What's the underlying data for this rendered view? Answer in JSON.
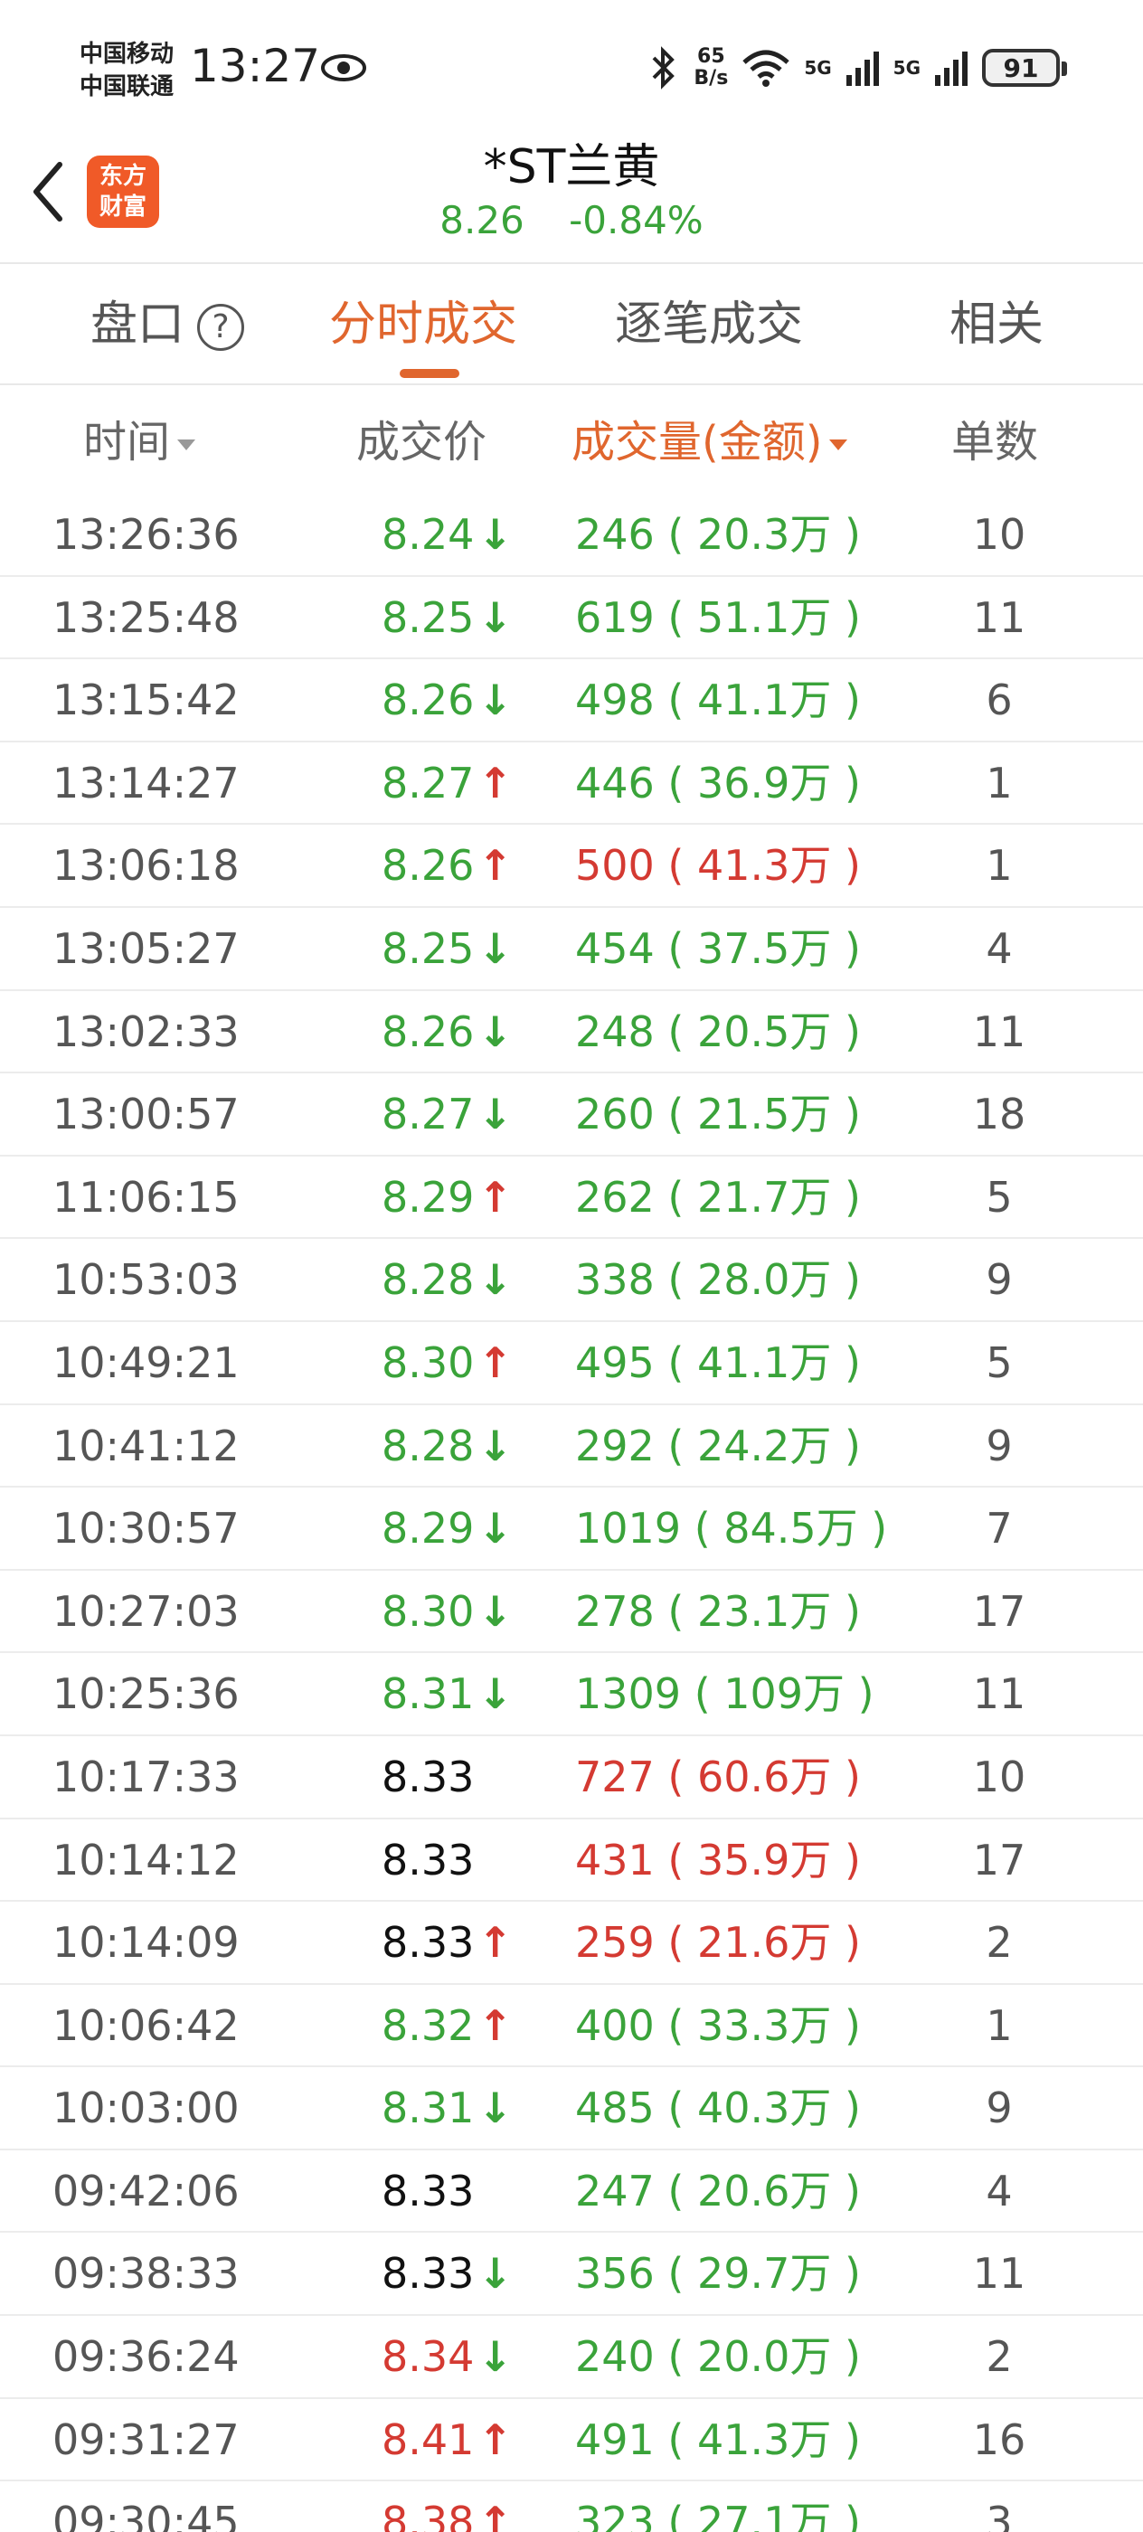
{
  "status_bar": {
    "carrier_1": "中国移动",
    "carrier_2": "中国联通",
    "time": "13:27",
    "net_speed_value": "65",
    "net_speed_unit": "B/s",
    "network_1": "5G",
    "network_2": "5G",
    "battery": "91"
  },
  "header": {
    "logo_line1": "东方",
    "logo_line2": "财富",
    "stock_name": "*ST兰黄",
    "price": "8.26",
    "change_pct": "-0.84%"
  },
  "tabs": [
    {
      "label": "盘口",
      "active": false
    },
    {
      "label": "分时成交",
      "active": true
    },
    {
      "label": "逐笔成交",
      "active": false
    },
    {
      "label": "相关",
      "active": false
    }
  ],
  "columns": {
    "time": "时间",
    "price": "成交价",
    "volume": "成交量(金额)",
    "count": "单数"
  },
  "trades": [
    {
      "time": "13:26:36",
      "price": "8.24",
      "price_color": "green",
      "dir": "down",
      "volume": "246 ( 20.3万 )",
      "vol_color": "green",
      "count": "10"
    },
    {
      "time": "13:25:48",
      "price": "8.25",
      "price_color": "green",
      "dir": "down",
      "volume": "619 ( 51.1万 )",
      "vol_color": "green",
      "count": "11"
    },
    {
      "time": "13:15:42",
      "price": "8.26",
      "price_color": "green",
      "dir": "down",
      "volume": "498 ( 41.1万 )",
      "vol_color": "green",
      "count": "6"
    },
    {
      "time": "13:14:27",
      "price": "8.27",
      "price_color": "green",
      "dir": "up",
      "volume": "446 ( 36.9万 )",
      "vol_color": "green",
      "count": "1"
    },
    {
      "time": "13:06:18",
      "price": "8.26",
      "price_color": "green",
      "dir": "up",
      "volume": "500 ( 41.3万 )",
      "vol_color": "red",
      "count": "1"
    },
    {
      "time": "13:05:27",
      "price": "8.25",
      "price_color": "green",
      "dir": "down",
      "volume": "454 ( 37.5万 )",
      "vol_color": "green",
      "count": "4"
    },
    {
      "time": "13:02:33",
      "price": "8.26",
      "price_color": "green",
      "dir": "down",
      "volume": "248 ( 20.5万 )",
      "vol_color": "green",
      "count": "11"
    },
    {
      "time": "13:00:57",
      "price": "8.27",
      "price_color": "green",
      "dir": "down",
      "volume": "260 ( 21.5万 )",
      "vol_color": "green",
      "count": "18"
    },
    {
      "time": "11:06:15",
      "price": "8.29",
      "price_color": "green",
      "dir": "up",
      "volume": "262 ( 21.7万 )",
      "vol_color": "green",
      "count": "5"
    },
    {
      "time": "10:53:03",
      "price": "8.28",
      "price_color": "green",
      "dir": "down",
      "volume": "338 ( 28.0万 )",
      "vol_color": "green",
      "count": "9"
    },
    {
      "time": "10:49:21",
      "price": "8.30",
      "price_color": "green",
      "dir": "up",
      "volume": "495 ( 41.1万 )",
      "vol_color": "green",
      "count": "5"
    },
    {
      "time": "10:41:12",
      "price": "8.28",
      "price_color": "green",
      "dir": "down",
      "volume": "292 ( 24.2万 )",
      "vol_color": "green",
      "count": "9"
    },
    {
      "time": "10:30:57",
      "price": "8.29",
      "price_color": "green",
      "dir": "down",
      "volume": "1019 ( 84.5万 )",
      "vol_color": "green",
      "count": "7"
    },
    {
      "time": "10:27:03",
      "price": "8.30",
      "price_color": "green",
      "dir": "down",
      "volume": "278 ( 23.1万 )",
      "vol_color": "green",
      "count": "17"
    },
    {
      "time": "10:25:36",
      "price": "8.31",
      "price_color": "green",
      "dir": "down",
      "volume": "1309 ( 109万 )",
      "vol_color": "green",
      "count": "11"
    },
    {
      "time": "10:17:33",
      "price": "8.33",
      "price_color": "black",
      "dir": "none",
      "volume": "727 ( 60.6万 )",
      "vol_color": "red",
      "count": "10"
    },
    {
      "time": "10:14:12",
      "price": "8.33",
      "price_color": "black",
      "dir": "none",
      "volume": "431 ( 35.9万 )",
      "vol_color": "red",
      "count": "17"
    },
    {
      "time": "10:14:09",
      "price": "8.33",
      "price_color": "black",
      "dir": "up",
      "volume": "259 ( 21.6万 )",
      "vol_color": "red",
      "count": "2"
    },
    {
      "time": "10:06:42",
      "price": "8.32",
      "price_color": "green",
      "dir": "up",
      "volume": "400 ( 33.3万 )",
      "vol_color": "green",
      "count": "1"
    },
    {
      "time": "10:03:00",
      "price": "8.31",
      "price_color": "green",
      "dir": "down",
      "volume": "485 ( 40.3万 )",
      "vol_color": "green",
      "count": "9"
    },
    {
      "time": "09:42:06",
      "price": "8.33",
      "price_color": "black",
      "dir": "none",
      "volume": "247 ( 20.6万 )",
      "vol_color": "green",
      "count": "4"
    },
    {
      "time": "09:38:33",
      "price": "8.33",
      "price_color": "black",
      "dir": "down",
      "volume": "356 ( 29.7万 )",
      "vol_color": "green",
      "count": "11"
    },
    {
      "time": "09:36:24",
      "price": "8.34",
      "price_color": "red",
      "dir": "down",
      "volume": "240 ( 20.0万 )",
      "vol_color": "green",
      "count": "2"
    },
    {
      "time": "09:31:27",
      "price": "8.41",
      "price_color": "red",
      "dir": "up",
      "volume": "491 ( 41.3万 )",
      "vol_color": "green",
      "count": "16"
    },
    {
      "time": "09:30:45",
      "price": "8.38",
      "price_color": "red",
      "dir": "up",
      "volume": "323 ( 27.1万 )",
      "vol_color": "green",
      "count": "3"
    }
  ]
}
